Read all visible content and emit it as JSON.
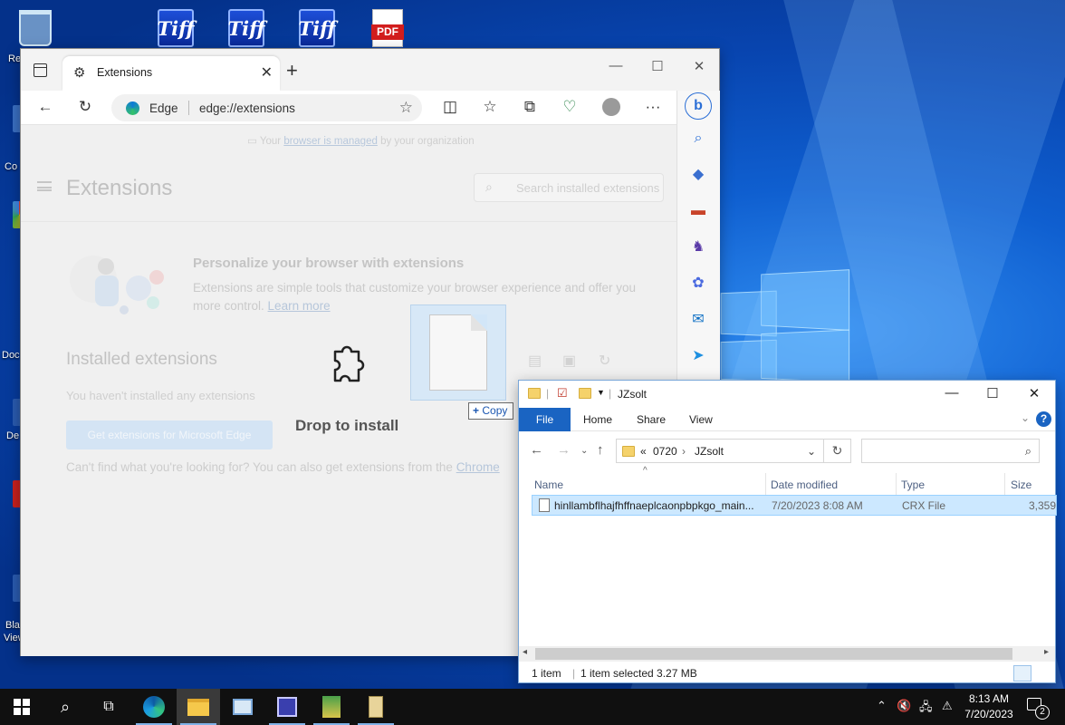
{
  "desktop": {
    "icons": [
      {
        "name": "tiff-1",
        "label": "Tiff"
      },
      {
        "name": "tiff-2",
        "label": "Tiff"
      },
      {
        "name": "tiff-3",
        "label": "Tiff"
      },
      {
        "name": "pdf",
        "label": "PDF"
      }
    ],
    "left_labels": [
      "Re",
      "Co",
      "Doc",
      "De",
      "Bla",
      "View"
    ]
  },
  "edge": {
    "tab_title": "Extensions",
    "site_label": "Edge",
    "url": "edge://extensions",
    "managed_prefix": "Your",
    "managed_link": "browser is managed",
    "managed_suffix": "by your organization",
    "page_title": "Extensions",
    "search_placeholder": "Search installed extensions",
    "promo_title": "Personalize your browser with extensions",
    "promo_text": "Extensions are simple tools that customize your browser experience and offer you more control.",
    "promo_link": "Learn more",
    "installed_title": "Installed extensions",
    "none_text": "You haven't installed any extensions",
    "get_button": "Get extensions for Microsoft Edge",
    "cantfind_text": "Can't find what you're looking for? You can also get extensions from the",
    "cantfind_link": "Chrome",
    "drop_label": "Drop to install",
    "copy_tip": "Copy",
    "copy_plus": "+"
  },
  "explorer": {
    "title": "JZsolt",
    "ribbon": {
      "file": "File",
      "home": "Home",
      "share": "Share",
      "view": "View",
      "help": "?"
    },
    "breadcrumb": {
      "overflow": "«",
      "parent": "0720",
      "current": "JZsolt"
    },
    "columns": {
      "name": "Name",
      "date": "Date modified",
      "type": "Type",
      "size": "Size"
    },
    "files": [
      {
        "name": "hinllambflhajfhffnaeplcaonpbpkgo_main...",
        "date": "7/20/2023 8:08 AM",
        "type": "CRX File",
        "size": "3,359"
      }
    ],
    "status": {
      "count": "1 item",
      "selected": "1 item selected  3.27 MB"
    }
  },
  "taskbar": {
    "time": "8:13 AM",
    "date": "7/20/2023",
    "notification_count": "2"
  },
  "colors": {
    "accent": "#1a64c2",
    "selection": "#cce8ff",
    "taskbar": "#101010"
  }
}
